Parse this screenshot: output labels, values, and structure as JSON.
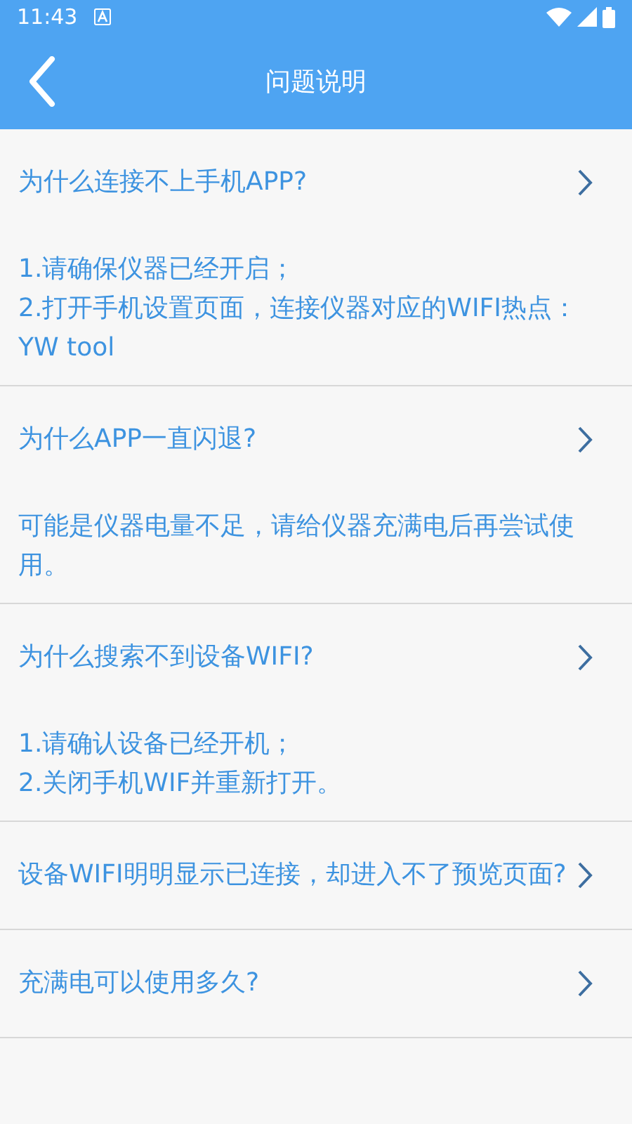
{
  "status_bar": {
    "time": "11:43"
  },
  "header": {
    "title": "问题说明"
  },
  "faq": [
    {
      "question": "为什么连接不上手机APP?",
      "answer": [
        "1.请确保仪器已经开启；",
        "2.打开手机设置页面，连接仪器对应的WIFI热点：YW tool"
      ]
    },
    {
      "question": "为什么APP一直闪退?",
      "answer": [
        "可能是仪器电量不足，请给仪器充满电后再尝试使用。"
      ]
    },
    {
      "question": "为什么搜索不到设备WIFI?",
      "answer": [
        "1.请确认设备已经开机；",
        "2.关闭手机WIF并重新打开。"
      ]
    },
    {
      "question": "设备WIFI明明显示已连接，却进入不了预览页面?"
    },
    {
      "question": "充满电可以使用多久?"
    }
  ]
}
